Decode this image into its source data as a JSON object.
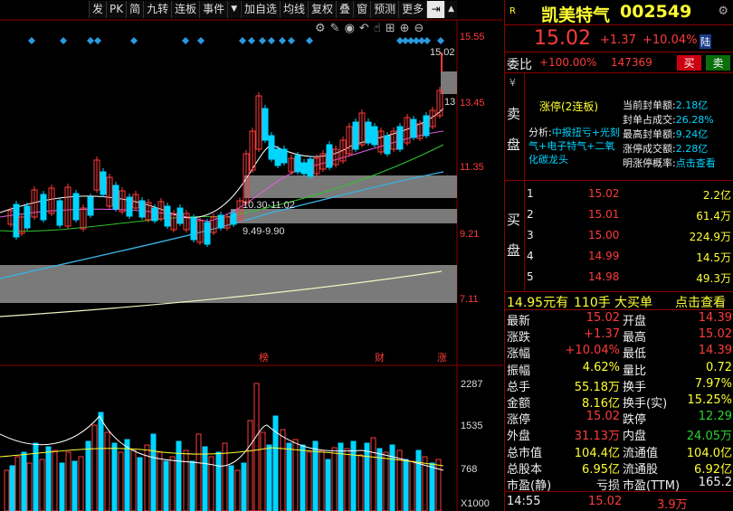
{
  "toolbar": {
    "left": [
      "发",
      "PK",
      "简",
      "九转",
      "连板",
      "事件",
      "▼"
    ],
    "right": [
      "加自选",
      "均线",
      "复权",
      "叠",
      "窗",
      "预测",
      "更多"
    ]
  },
  "chart": {
    "price_labels": [
      "15.55",
      "13.45",
      "11.35",
      "9.21",
      "7.11"
    ],
    "vol_labels": [
      "2287",
      "1535",
      "768",
      "X1000"
    ],
    "max_price": "15.02",
    "near_top": "13",
    "gap1": "10.30-11.02",
    "gap2": "9.49-9.90",
    "markers": [
      "榜",
      "财",
      "涨"
    ]
  },
  "stock": {
    "name": "凯美特气",
    "code": "002549",
    "badge": "R",
    "price": "15.02",
    "change": "+1.37",
    "pct": "+10.04%",
    "tag": "陆"
  },
  "weibi": {
    "label": "委比",
    "pct": "+100.00%",
    "diff": "147369",
    "buy_btn": "买",
    "sell_btn": "卖"
  },
  "sell_side": {
    "label1": "卖",
    "label2": "盘",
    "ruler": "¥"
  },
  "limit": {
    "title": "涨停(2连板)",
    "analysis_label": "分析:",
    "analysis": "中报扭亏+光刻气+电子特气+二氧化碳龙头",
    "stats": [
      {
        "k": "当前封单额:",
        "v": "2.18亿"
      },
      {
        "k": "封单占成交:",
        "v": "26.28%"
      },
      {
        "k": "最高封单额:",
        "v": "9.24亿"
      },
      {
        "k": "涨停成交额:",
        "v": "2.28亿"
      },
      {
        "k": "明涨停概率:",
        "v": "点击查看"
      }
    ]
  },
  "buy_side": {
    "label1": "买",
    "label2": "盘",
    "rows": [
      {
        "n": "1",
        "p": "15.02",
        "v": "2.2亿"
      },
      {
        "n": "2",
        "p": "15.01",
        "v": "61.4万"
      },
      {
        "n": "3",
        "p": "15.00",
        "v": "224.9万"
      },
      {
        "n": "4",
        "p": "14.99",
        "v": "14.5万"
      },
      {
        "n": "5",
        "p": "14.98",
        "v": "49.3万"
      }
    ]
  },
  "big_order": {
    "price": "14.95元有",
    "qty": "110手",
    "label": "大买单",
    "link": "点击查看"
  },
  "quote": [
    {
      "k1": "最新",
      "v1": "15.02",
      "c1": "red",
      "k2": "开盘",
      "v2": "14.39",
      "c2": "red"
    },
    {
      "k1": "涨跌",
      "v1": "+1.37",
      "c1": "red",
      "k2": "最高",
      "v2": "15.02",
      "c2": "red"
    },
    {
      "k1": "涨幅",
      "v1": "+10.04%",
      "c1": "red",
      "k2": "最低",
      "v2": "14.39",
      "c2": "red"
    },
    {
      "k1": "振幅",
      "v1": "4.62%",
      "c1": "yel",
      "k2": "量比",
      "v2": "0.72",
      "c2": "yel"
    },
    {
      "k1": "总手",
      "v1": "55.18万",
      "c1": "yel",
      "k2": "换手",
      "v2": "7.97%",
      "c2": "yel"
    },
    {
      "k1": "金额",
      "v1": "8.16亿",
      "c1": "yel",
      "k2": "换手(实)",
      "v2": "15.25%",
      "c2": "yel"
    },
    {
      "k1": "涨停",
      "v1": "15.02",
      "c1": "red",
      "k2": "跌停",
      "v2": "12.29",
      "c2": "green"
    },
    {
      "k1": "外盘",
      "v1": "31.13万",
      "c1": "red",
      "k2": "内盘",
      "v2": "24.05万",
      "c2": "green"
    },
    {
      "k1": "总市值",
      "v1": "104.4亿",
      "c1": "yel",
      "k2": "流通值",
      "v2": "104.0亿",
      "c2": "yel"
    },
    {
      "k1": "总股本",
      "v1": "6.95亿",
      "c1": "yel",
      "k2": "流通股",
      "v2": "6.92亿",
      "c2": "yel"
    },
    {
      "k1": "市盈(静)",
      "v1": "亏损",
      "c1": "wht",
      "k2": "市盈(TTM)",
      "v2": "165.2",
      "c2": "wht"
    }
  ],
  "tick": {
    "time": "14:55",
    "price": "15.02",
    "vol": "3.9万"
  },
  "colors": {
    "up": "#ff3b3b",
    "down": "#00d4ff",
    "accent": "#ffff33"
  }
}
